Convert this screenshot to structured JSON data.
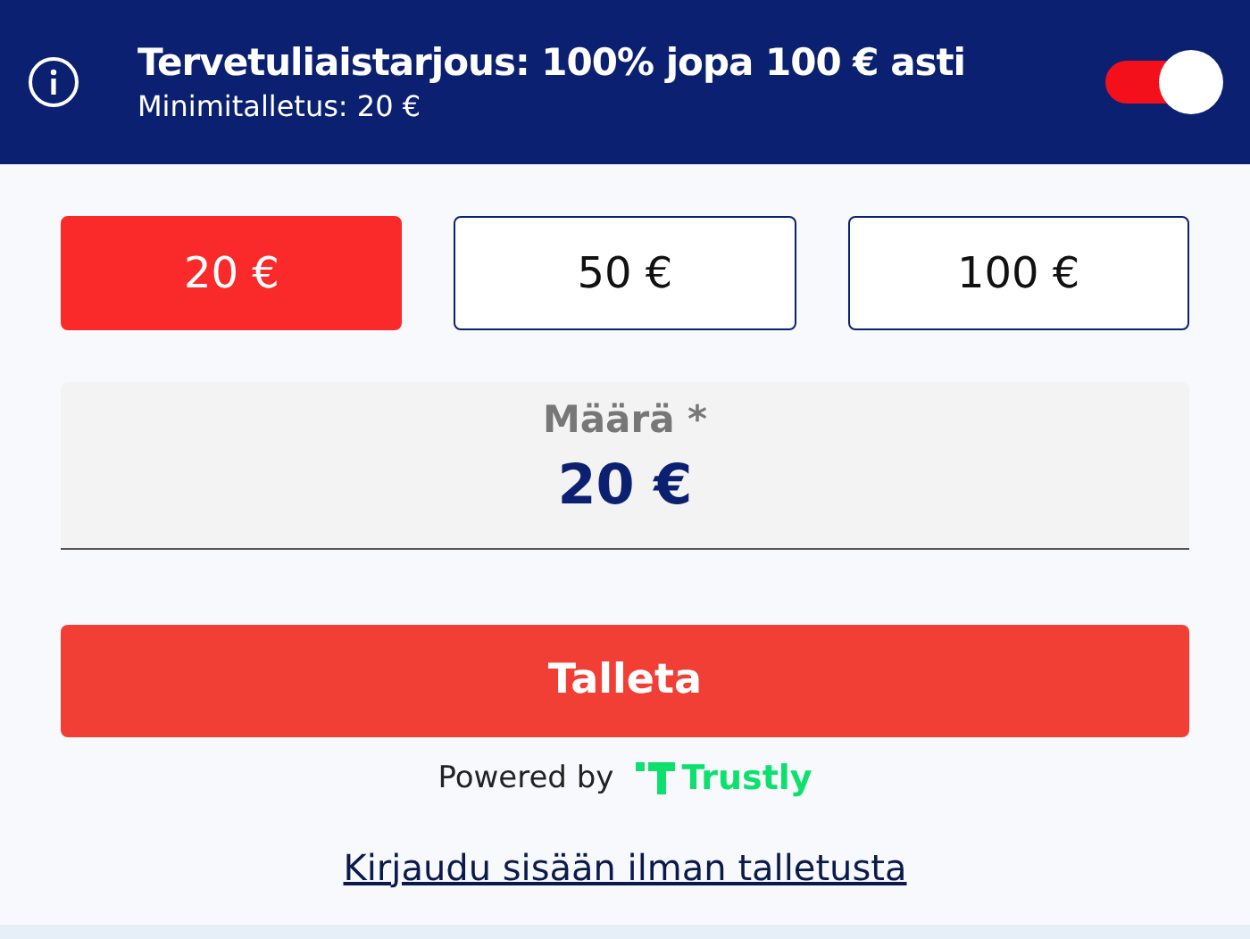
{
  "banner": {
    "title": "Tervetuliaistarjous: 100% jopa 100 € asti",
    "subtitle": "Minimitalletus: 20 €",
    "toggle_on": true
  },
  "amounts": [
    {
      "label": "20 €",
      "selected": true
    },
    {
      "label": "50 €",
      "selected": false
    },
    {
      "label": "100 €",
      "selected": false
    }
  ],
  "amount_field": {
    "label": "Määrä *",
    "value": "20 €"
  },
  "submit": "Talleta",
  "powered_by": {
    "text": "Powered by",
    "brand": "Trustly"
  },
  "login_link": "Kirjaudu sisään ilman talletusta"
}
